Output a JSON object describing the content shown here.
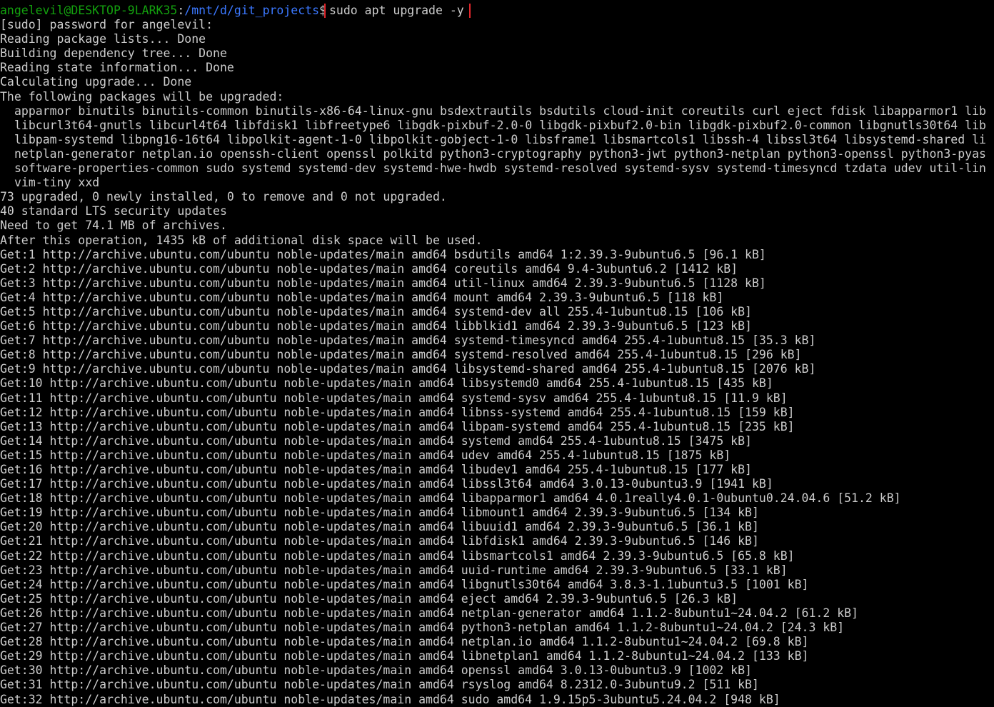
{
  "colors": {
    "background": "#000000",
    "text": "#cccccc",
    "prompt_user": "#13a10e",
    "prompt_path": "#3b78ff",
    "highlight_box": "#e0262b"
  },
  "prompt": {
    "user_host": "angelevil@DESKTOP-9LARK35",
    "colon": ":",
    "path": "/mnt/d/git_projects",
    "dollar": "$",
    "command": "sudo apt upgrade -y"
  },
  "output_lines": [
    "[sudo] password for angelevil:",
    "Reading package lists... Done",
    "Building dependency tree... Done",
    "Reading state information... Done",
    "Calculating upgrade... Done",
    "The following packages will be upgraded:"
  ],
  "package_lines": [
    "apparmor binutils binutils-common binutils-x86-64-linux-gnu bsdextrautils bsdutils cloud-init coreutils curl eject fdisk libapparmor1 lib",
    "libcurl3t64-gnutls libcurl4t64 libfdisk1 libfreetype6 libgdk-pixbuf-2.0-0 libgdk-pixbuf2.0-bin libgdk-pixbuf2.0-common libgnutls30t64 lib",
    "libpam-systemd libpng16-16t64 libpolkit-agent-1-0 libpolkit-gobject-1-0 libsframe1 libsmartcols1 libssh-4 libssl3t64 libsystemd-shared li",
    "netplan-generator netplan.io openssh-client openssl polkitd python3-cryptography python3-jwt python3-netplan python3-openssl python3-pyas",
    "software-properties-common sudo systemd systemd-dev systemd-hwe-hwdb systemd-resolved systemd-sysv systemd-timesyncd tzdata udev util-lin",
    "vim-tiny xxd"
  ],
  "summary_lines": [
    "73 upgraded, 0 newly installed, 0 to remove and 0 not upgraded.",
    "40 standard LTS security updates",
    "Need to get 74.1 MB of archives.",
    "After this operation, 1435 kB of additional disk space will be used."
  ],
  "get_lines": [
    "Get:1 http://archive.ubuntu.com/ubuntu noble-updates/main amd64 bsdutils amd64 1:2.39.3-9ubuntu6.5 [96.1 kB]",
    "Get:2 http://archive.ubuntu.com/ubuntu noble-updates/main amd64 coreutils amd64 9.4-3ubuntu6.2 [1412 kB]",
    "Get:3 http://archive.ubuntu.com/ubuntu noble-updates/main amd64 util-linux amd64 2.39.3-9ubuntu6.5 [1128 kB]",
    "Get:4 http://archive.ubuntu.com/ubuntu noble-updates/main amd64 mount amd64 2.39.3-9ubuntu6.5 [118 kB]",
    "Get:5 http://archive.ubuntu.com/ubuntu noble-updates/main amd64 systemd-dev all 255.4-1ubuntu8.15 [106 kB]",
    "Get:6 http://archive.ubuntu.com/ubuntu noble-updates/main amd64 libblkid1 amd64 2.39.3-9ubuntu6.5 [123 kB]",
    "Get:7 http://archive.ubuntu.com/ubuntu noble-updates/main amd64 systemd-timesyncd amd64 255.4-1ubuntu8.15 [35.3 kB]",
    "Get:8 http://archive.ubuntu.com/ubuntu noble-updates/main amd64 systemd-resolved amd64 255.4-1ubuntu8.15 [296 kB]",
    "Get:9 http://archive.ubuntu.com/ubuntu noble-updates/main amd64 libsystemd-shared amd64 255.4-1ubuntu8.15 [2076 kB]",
    "Get:10 http://archive.ubuntu.com/ubuntu noble-updates/main amd64 libsystemd0 amd64 255.4-1ubuntu8.15 [435 kB]",
    "Get:11 http://archive.ubuntu.com/ubuntu noble-updates/main amd64 systemd-sysv amd64 255.4-1ubuntu8.15 [11.9 kB]",
    "Get:12 http://archive.ubuntu.com/ubuntu noble-updates/main amd64 libnss-systemd amd64 255.4-1ubuntu8.15 [159 kB]",
    "Get:13 http://archive.ubuntu.com/ubuntu noble-updates/main amd64 libpam-systemd amd64 255.4-1ubuntu8.15 [235 kB]",
    "Get:14 http://archive.ubuntu.com/ubuntu noble-updates/main amd64 systemd amd64 255.4-1ubuntu8.15 [3475 kB]",
    "Get:15 http://archive.ubuntu.com/ubuntu noble-updates/main amd64 udev amd64 255.4-1ubuntu8.15 [1875 kB]",
    "Get:16 http://archive.ubuntu.com/ubuntu noble-updates/main amd64 libudev1 amd64 255.4-1ubuntu8.15 [177 kB]",
    "Get:17 http://archive.ubuntu.com/ubuntu noble-updates/main amd64 libssl3t64 amd64 3.0.13-0ubuntu3.9 [1941 kB]",
    "Get:18 http://archive.ubuntu.com/ubuntu noble-updates/main amd64 libapparmor1 amd64 4.0.1really4.0.1-0ubuntu0.24.04.6 [51.2 kB]",
    "Get:19 http://archive.ubuntu.com/ubuntu noble-updates/main amd64 libmount1 amd64 2.39.3-9ubuntu6.5 [134 kB]",
    "Get:20 http://archive.ubuntu.com/ubuntu noble-updates/main amd64 libuuid1 amd64 2.39.3-9ubuntu6.5 [36.1 kB]",
    "Get:21 http://archive.ubuntu.com/ubuntu noble-updates/main amd64 libfdisk1 amd64 2.39.3-9ubuntu6.5 [146 kB]",
    "Get:22 http://archive.ubuntu.com/ubuntu noble-updates/main amd64 libsmartcols1 amd64 2.39.3-9ubuntu6.5 [65.8 kB]",
    "Get:23 http://archive.ubuntu.com/ubuntu noble-updates/main amd64 uuid-runtime amd64 2.39.3-9ubuntu6.5 [33.1 kB]",
    "Get:24 http://archive.ubuntu.com/ubuntu noble-updates/main amd64 libgnutls30t64 amd64 3.8.3-1.1ubuntu3.5 [1001 kB]",
    "Get:25 http://archive.ubuntu.com/ubuntu noble-updates/main amd64 eject amd64 2.39.3-9ubuntu6.5 [26.3 kB]",
    "Get:26 http://archive.ubuntu.com/ubuntu noble-updates/main amd64 netplan-generator amd64 1.1.2-8ubuntu1~24.04.2 [61.2 kB]",
    "Get:27 http://archive.ubuntu.com/ubuntu noble-updates/main amd64 python3-netplan amd64 1.1.2-8ubuntu1~24.04.2 [24.3 kB]",
    "Get:28 http://archive.ubuntu.com/ubuntu noble-updates/main amd64 netplan.io amd64 1.1.2-8ubuntu1~24.04.2 [69.8 kB]",
    "Get:29 http://archive.ubuntu.com/ubuntu noble-updates/main amd64 libnetplan1 amd64 1.1.2-8ubuntu1~24.04.2 [133 kB]",
    "Get:30 http://archive.ubuntu.com/ubuntu noble-updates/main amd64 openssl amd64 3.0.13-0ubuntu3.9 [1002 kB]",
    "Get:31 http://archive.ubuntu.com/ubuntu noble-updates/main amd64 rsyslog amd64 8.2312.0-3ubuntu9.2 [511 kB]",
    "Get:32 http://archive.ubuntu.com/ubuntu noble-updates/main amd64 sudo amd64 1.9.15p5-3ubuntu5.24.04.2 [948 kB]"
  ]
}
